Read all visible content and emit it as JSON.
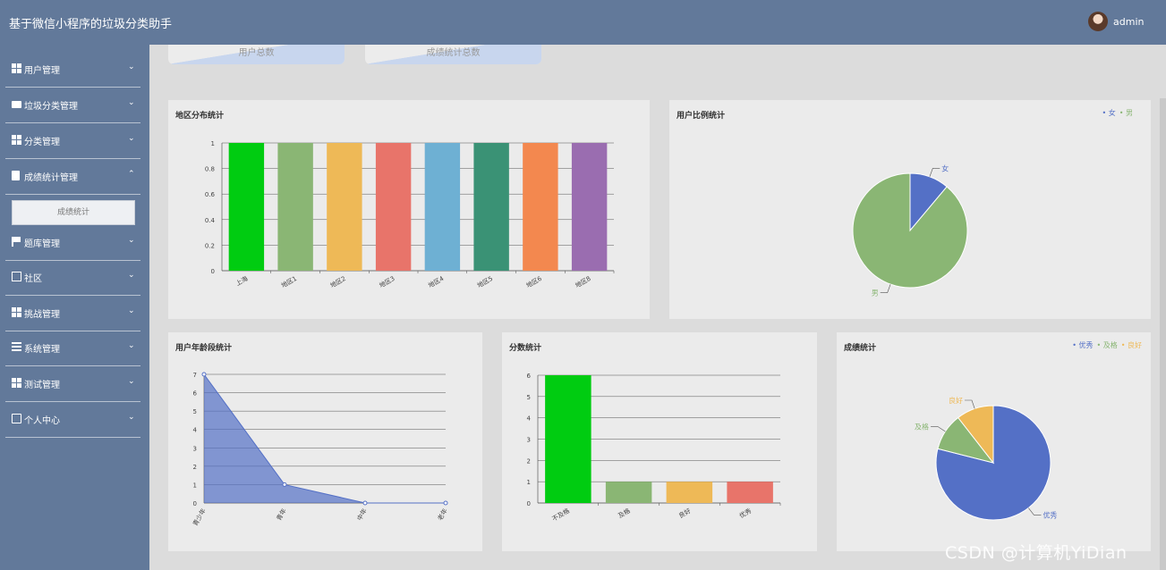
{
  "header": {
    "app_title": "基于微信小程序的垃圾分类助手",
    "username": "admin"
  },
  "sidebar": {
    "items": [
      {
        "label": "用户管理",
        "icon": "grid-icon",
        "chevron": "⌄"
      },
      {
        "label": "垃圾分类管理",
        "icon": "briefcase-icon",
        "chevron": "⌄"
      },
      {
        "label": "分类管理",
        "icon": "grid-icon",
        "chevron": "⌄"
      },
      {
        "label": "成绩统计管理",
        "icon": "clipboard-icon",
        "chevron": "⌃"
      },
      {
        "label": "题库管理",
        "icon": "flag-icon",
        "chevron": "⌄"
      },
      {
        "label": "社区",
        "icon": "chart-icon",
        "chevron": "⌄"
      },
      {
        "label": "挑战管理",
        "icon": "grid-icon",
        "chevron": "⌄"
      },
      {
        "label": "系统管理",
        "icon": "list-icon",
        "chevron": "⌄"
      },
      {
        "label": "测试管理",
        "icon": "grid-icon",
        "chevron": "⌄"
      },
      {
        "label": "个人中心",
        "icon": "card-icon",
        "chevron": "⌄"
      }
    ],
    "submenu_label": "成绩统计"
  },
  "stat_cards": [
    {
      "label": "用户总数"
    },
    {
      "label": "成绩统计总数"
    }
  ],
  "panels": {
    "region": {
      "title": "地区分布统计"
    },
    "gender": {
      "title": "用户比例统计"
    },
    "age": {
      "title": "用户年龄段统计"
    },
    "score": {
      "title": "分数统计"
    },
    "grade": {
      "title": "成绩统计"
    }
  },
  "watermark": "CSDN @计算机YiDian",
  "chart_data": [
    {
      "type": "bar",
      "title": "地区分布统计",
      "categories": [
        "上海",
        "地区1",
        "地区2",
        "地区3",
        "地区4",
        "地区5",
        "地区6",
        "地区8"
      ],
      "values": [
        1,
        1,
        1,
        1,
        1,
        1,
        1,
        1
      ],
      "colors": [
        "#00cc11",
        "#8ab674",
        "#eeb957",
        "#e8746a",
        "#6eb0d3",
        "#3a9275",
        "#f3884f",
        "#9a6db0"
      ],
      "ylim": [
        0,
        1
      ],
      "yticks": [
        "0",
        "0.2",
        "0.4",
        "0.6",
        "0.8",
        "1"
      ],
      "grid": true
    },
    {
      "type": "pie",
      "title": "用户比例统计",
      "labels": [
        "女",
        "男"
      ],
      "values": [
        1,
        8
      ],
      "colors": [
        "#5470c6",
        "#8ab674"
      ],
      "legend": "top-right"
    },
    {
      "type": "area",
      "title": "用户年龄段统计",
      "categories": [
        "青少年",
        "青年",
        "中年",
        "老年"
      ],
      "values": [
        7,
        1,
        0,
        0
      ],
      "color": "#5470c6",
      "ylim": [
        0,
        7
      ],
      "yticks": [
        "0",
        "1",
        "2",
        "3",
        "4",
        "5",
        "6",
        "7"
      ],
      "grid": true
    },
    {
      "type": "bar",
      "title": "分数统计",
      "categories": [
        "不及格",
        "及格",
        "良好",
        "优秀"
      ],
      "values": [
        6,
        1,
        1,
        1
      ],
      "colors": [
        "#00cc11",
        "#8ab674",
        "#eeb957",
        "#e8746a"
      ],
      "ylim": [
        0,
        6
      ],
      "yticks": [
        "0",
        "1",
        "2",
        "3",
        "4",
        "5",
        "6"
      ],
      "grid": true
    },
    {
      "type": "pie",
      "title": "成绩统计",
      "labels": [
        "优秀",
        "及格",
        "良好"
      ],
      "values": [
        15,
        2,
        2
      ],
      "colors": [
        "#5470c6",
        "#8ab674",
        "#eeb957"
      ],
      "legend": "top-right"
    }
  ]
}
